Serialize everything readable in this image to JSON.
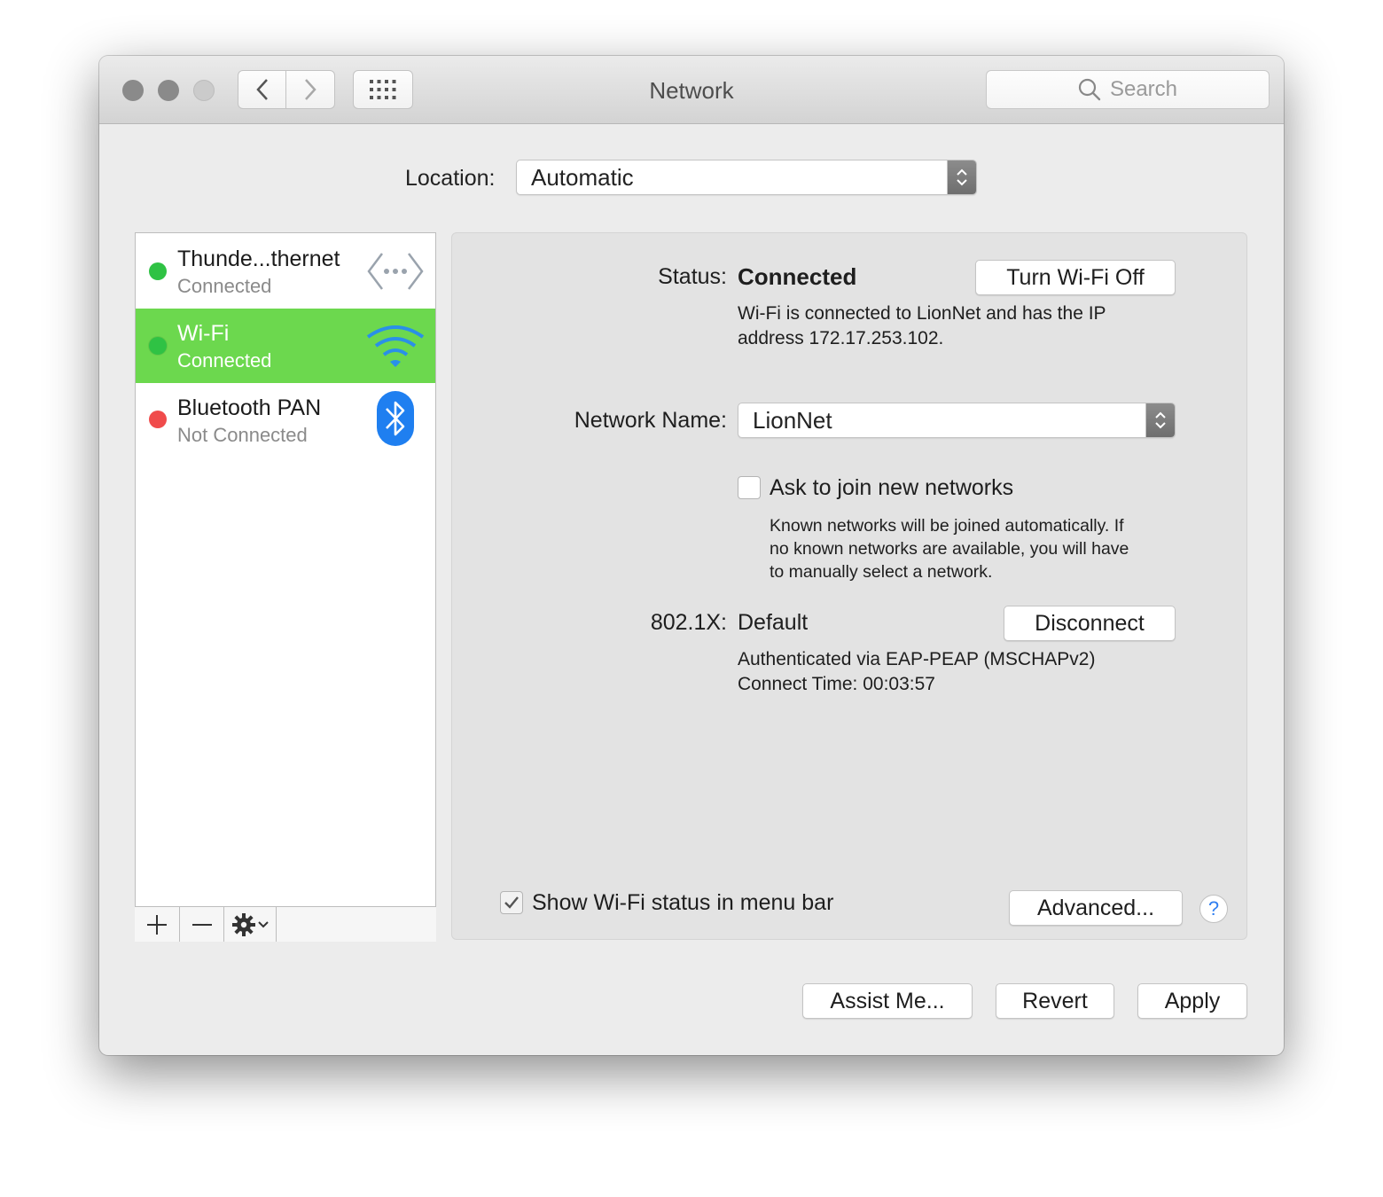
{
  "window": {
    "title": "Network",
    "search_placeholder": "Search"
  },
  "location": {
    "label": "Location:",
    "value": "Automatic"
  },
  "services": [
    {
      "name": "Thunde...thernet",
      "status": "Connected",
      "status_color": "#2fc244",
      "icon": "ethernet-icon"
    },
    {
      "name": "Wi-Fi",
      "status": "Connected",
      "status_color": "#2fc244",
      "icon": "wifi-icon",
      "selected": true
    },
    {
      "name": "Bluetooth PAN",
      "status": "Not Connected",
      "status_color": "#f04b4b",
      "icon": "bluetooth-icon"
    }
  ],
  "detail": {
    "status_label": "Status:",
    "status_value": "Connected",
    "turn_off_button": "Turn Wi-Fi Off",
    "status_desc_line1": "Wi-Fi is connected to LionNet and has the IP",
    "status_desc_line2": "address 172.17.253.102.",
    "network_name_label": "Network Name:",
    "network_name_value": "LionNet",
    "ask_join_label": "Ask to join new networks",
    "ask_join_checked": false,
    "ask_join_desc_line1": "Known networks will be joined automatically. If",
    "ask_join_desc_line2": "no known networks are available, you will have",
    "ask_join_desc_line3": "to manually select a network.",
    "dot1x_label": "802.1X:",
    "dot1x_value": "Default",
    "disconnect_button": "Disconnect",
    "auth_line": "Authenticated via EAP-PEAP (MSCHAPv2)",
    "connect_time": "Connect Time: 00:03:57",
    "show_status_label": "Show Wi-Fi status in menu bar",
    "show_status_checked": true,
    "advanced_button": "Advanced...",
    "help_button": "?"
  },
  "footer": {
    "assist_button": "Assist Me...",
    "revert_button": "Revert",
    "apply_button": "Apply"
  },
  "colors": {
    "selected_row": "#6cd84e",
    "accent_blue": "#2f7ef0"
  }
}
